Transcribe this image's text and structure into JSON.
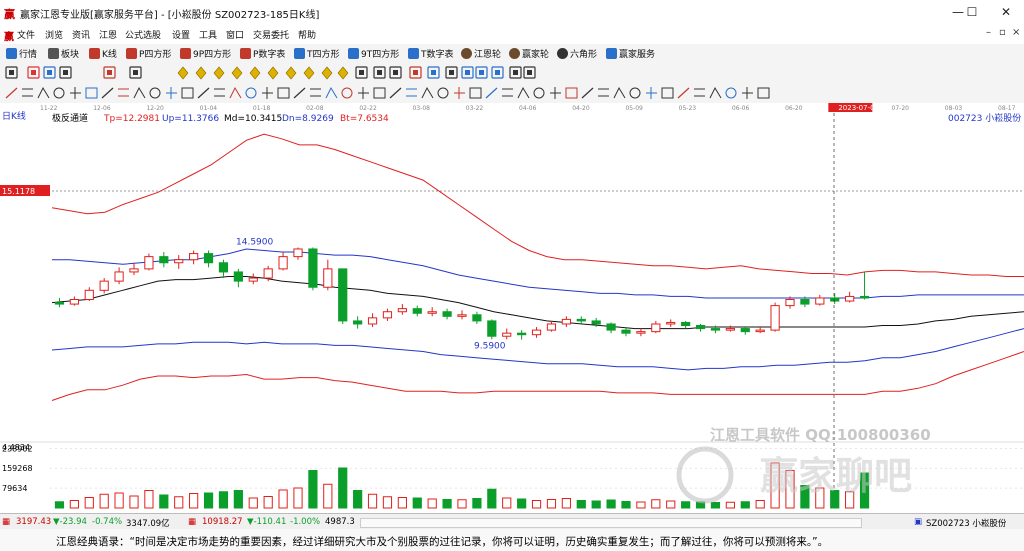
{
  "window": {
    "app_logo": "赢",
    "title": "赢家江恩专业版[赢家服务平台] - [小崧股份   SZ002723-185日K线]",
    "minimize": "—",
    "maximize": "☐",
    "close": "✕"
  },
  "menu": {
    "logo": "赢",
    "items": [
      "文件",
      "浏览",
      "资讯",
      "江恩",
      "公式选股",
      "设置",
      "工具",
      "窗口",
      "交易委托",
      "帮助"
    ],
    "win_controls": [
      "–",
      "▫",
      "×"
    ]
  },
  "toolbar1": {
    "items": [
      {
        "label": "行情",
        "color": "#2a6fc9"
      },
      {
        "label": "板块",
        "color": "#333"
      },
      {
        "label": "K线",
        "color": "#c0392b"
      },
      {
        "label": "P四方形",
        "color": "#c0392b"
      },
      {
        "label": "9P四方形",
        "color": "#c0392b"
      },
      {
        "label": "P数字表",
        "color": "#c0392b"
      },
      {
        "label": "T四方形",
        "color": "#2a6fc9"
      },
      {
        "label": "9T四方形",
        "color": "#2a6fc9"
      },
      {
        "label": "T数字表",
        "color": "#2a6fc9"
      },
      {
        "label": "江恩轮",
        "color": "#333"
      },
      {
        "label": "赢家轮",
        "color": "#333"
      },
      {
        "label": "六角形",
        "color": "#333"
      },
      {
        "label": "赢家服务",
        "color": "#333"
      }
    ]
  },
  "chart_header": {
    "period": "日K线",
    "indicator": "极反通道",
    "tp_label": "Tp=12.2981",
    "up_label": "Up=11.3766",
    "md_label": "Md=10.3415",
    "dn_label": "Dn=8.9269",
    "bt_label": "Bt=7.6534",
    "stock": "002723 小崧股份"
  },
  "chart_data": {
    "type": "candlestick",
    "price_ylim": [
      6.8,
      16.6
    ],
    "price_marker": "15.1178",
    "high_annotation": "14.5900",
    "low_annotation": "9.5900",
    "cursor_date": "2023-07-04",
    "x_ticks": [
      "11-22",
      "12-06",
      "12-20",
      "01-04",
      "01-18",
      "02-08",
      "02-22",
      "03-08",
      "03-22",
      "04-06",
      "04-20",
      "05-09",
      "05-23",
      "06-06",
      "06-20",
      "2023-07-04",
      "07-20",
      "08-03",
      "08-17"
    ],
    "volume_ticks": [
      "4.4834",
      "238902",
      "159268",
      "79634"
    ],
    "bands": {
      "top_red": [
        13.9,
        13.8,
        13.7,
        13.75,
        14.0,
        14.2,
        14.4,
        14.7,
        15.0,
        15.3,
        15.7,
        16.1,
        16.3,
        16.15,
        15.95,
        15.95,
        15.8,
        15.6,
        15.4,
        15.2,
        15.0,
        14.8,
        14.4,
        14.0,
        13.6,
        13.2,
        12.8,
        12.5,
        12.3,
        12.2,
        12.2,
        12.15,
        12.1,
        12.05,
        12.0,
        12.0,
        11.95,
        11.9,
        11.95,
        12.0,
        11.9,
        11.85,
        11.8,
        11.75,
        11.75,
        11.7,
        11.8,
        11.85,
        11.85,
        11.8,
        11.8,
        11.75,
        11.7,
        11.7,
        11.65,
        11.65
      ],
      "upper_blue": [
        12.2,
        12.2,
        12.15,
        12.1,
        12.05,
        12.1,
        12.15,
        12.2,
        12.2,
        12.3,
        12.4,
        12.55,
        12.5,
        12.45,
        12.45,
        12.4,
        12.35,
        12.35,
        12.3,
        12.2,
        12.1,
        12.0,
        11.85,
        11.7,
        11.6,
        11.5,
        11.4,
        11.3,
        11.25,
        11.2,
        11.15,
        11.1,
        11.1,
        11.05,
        11.05,
        11.0,
        11.0,
        10.95,
        10.95,
        10.95,
        10.95,
        10.95,
        10.95,
        10.95,
        10.95,
        10.95,
        10.95,
        11.0,
        11.0,
        11.05,
        11.05,
        11.05,
        11.05,
        11.05,
        11.05,
        11.05
      ],
      "mid_black": [
        10.8,
        10.85,
        10.9,
        11.05,
        11.2,
        11.35,
        11.5,
        11.55,
        11.55,
        11.6,
        11.65,
        11.65,
        11.6,
        11.5,
        11.45,
        11.4,
        11.3,
        11.25,
        11.2,
        11.1,
        11.05,
        11.0,
        10.9,
        10.8,
        10.65,
        10.5,
        10.4,
        10.3,
        10.2,
        10.15,
        10.1,
        10.05,
        10.0,
        9.95,
        9.95,
        9.95,
        9.95,
        10.0,
        10.0,
        10.0,
        10.0,
        10.0,
        10.0,
        10.0,
        10.0,
        10.0,
        10.0,
        10.05,
        10.05,
        10.1,
        10.2,
        10.25,
        10.35,
        10.4,
        10.45,
        10.5
      ],
      "lower_blue": [
        9.25,
        9.3,
        9.35,
        9.35,
        9.35,
        9.4,
        9.45,
        9.45,
        9.5,
        9.5,
        9.5,
        9.45,
        9.5,
        9.45,
        9.45,
        9.45,
        9.4,
        9.4,
        9.35,
        9.3,
        9.25,
        9.2,
        9.1,
        9.05,
        9.0,
        8.95,
        8.9,
        8.85,
        8.8,
        8.8,
        8.8,
        8.75,
        8.7,
        8.7,
        8.7,
        8.65,
        8.6,
        8.65,
        8.65,
        8.7,
        8.7,
        8.75,
        8.75,
        8.8,
        8.85,
        8.85,
        8.9,
        9.0,
        9.0,
        9.1,
        9.2,
        9.35,
        9.5,
        9.65,
        9.8,
        9.95
      ],
      "bottom_red": [
        7.6,
        7.8,
        7.95,
        7.95,
        8.1,
        8.3,
        8.4,
        8.4,
        8.35,
        8.4,
        8.4,
        8.45,
        8.3,
        8.3,
        8.35,
        8.35,
        8.25,
        8.2,
        8.1,
        8.0,
        7.9,
        7.9,
        7.9,
        7.85,
        7.85,
        7.9,
        7.9,
        7.9,
        7.9,
        7.9,
        7.9,
        7.9,
        7.85,
        7.85,
        7.85,
        7.8,
        7.8,
        7.8,
        7.8,
        7.8,
        7.8,
        7.8,
        7.8,
        7.8,
        7.8,
        7.8,
        7.8,
        7.9,
        7.9,
        8.0,
        8.15,
        8.4,
        8.6,
        8.8,
        9.0,
        9.2
      ]
    },
    "candles": [
      {
        "o": 10.8,
        "c": 10.75,
        "h": 10.95,
        "l": 10.65,
        "v": 25000
      },
      {
        "o": 10.75,
        "c": 10.9,
        "h": 11.0,
        "l": 10.7,
        "v": 30000
      },
      {
        "o": 10.9,
        "c": 11.2,
        "h": 11.3,
        "l": 10.85,
        "v": 42000
      },
      {
        "o": 11.2,
        "c": 11.5,
        "h": 11.6,
        "l": 11.1,
        "v": 55000
      },
      {
        "o": 11.5,
        "c": 11.8,
        "h": 11.95,
        "l": 11.4,
        "v": 60000
      },
      {
        "o": 11.8,
        "c": 11.9,
        "h": 12.1,
        "l": 11.7,
        "v": 48000
      },
      {
        "o": 11.9,
        "c": 12.3,
        "h": 12.4,
        "l": 11.85,
        "v": 70000
      },
      {
        "o": 12.3,
        "c": 12.1,
        "h": 12.45,
        "l": 11.95,
        "v": 52000
      },
      {
        "o": 12.1,
        "c": 12.2,
        "h": 12.35,
        "l": 11.9,
        "v": 45000
      },
      {
        "o": 12.2,
        "c": 12.4,
        "h": 12.5,
        "l": 12.05,
        "v": 58000
      },
      {
        "o": 12.4,
        "c": 12.1,
        "h": 12.5,
        "l": 11.95,
        "v": 60000
      },
      {
        "o": 12.1,
        "c": 11.8,
        "h": 12.2,
        "l": 11.6,
        "v": 65000
      },
      {
        "o": 11.8,
        "c": 11.5,
        "h": 11.9,
        "l": 11.3,
        "v": 70000
      },
      {
        "o": 11.5,
        "c": 11.6,
        "h": 11.75,
        "l": 11.4,
        "v": 40000
      },
      {
        "o": 11.6,
        "c": 11.9,
        "h": 12.0,
        "l": 11.5,
        "v": 46000
      },
      {
        "o": 11.9,
        "c": 12.3,
        "h": 12.45,
        "l": 11.85,
        "v": 72000
      },
      {
        "o": 12.3,
        "c": 12.55,
        "h": 12.6,
        "l": 12.2,
        "v": 80000
      },
      {
        "o": 12.55,
        "c": 11.3,
        "h": 12.6,
        "l": 11.2,
        "v": 150000
      },
      {
        "o": 11.3,
        "c": 11.9,
        "h": 12.2,
        "l": 11.2,
        "v": 95000
      },
      {
        "o": 11.9,
        "c": 10.2,
        "h": 11.9,
        "l": 10.1,
        "v": 160000
      },
      {
        "o": 10.2,
        "c": 10.1,
        "h": 10.35,
        "l": 9.95,
        "v": 70000
      },
      {
        "o": 10.1,
        "c": 10.3,
        "h": 10.45,
        "l": 10.0,
        "v": 55000
      },
      {
        "o": 10.3,
        "c": 10.5,
        "h": 10.6,
        "l": 10.2,
        "v": 45000
      },
      {
        "o": 10.5,
        "c": 10.6,
        "h": 10.75,
        "l": 10.4,
        "v": 42000
      },
      {
        "o": 10.6,
        "c": 10.45,
        "h": 10.7,
        "l": 10.35,
        "v": 40000
      },
      {
        "o": 10.45,
        "c": 10.5,
        "h": 10.65,
        "l": 10.35,
        "v": 36000
      },
      {
        "o": 10.5,
        "c": 10.35,
        "h": 10.6,
        "l": 10.25,
        "v": 34000
      },
      {
        "o": 10.35,
        "c": 10.4,
        "h": 10.55,
        "l": 10.25,
        "v": 33000
      },
      {
        "o": 10.4,
        "c": 10.2,
        "h": 10.5,
        "l": 10.1,
        "v": 38000
      },
      {
        "o": 10.2,
        "c": 9.7,
        "h": 10.25,
        "l": 9.6,
        "v": 75000
      },
      {
        "o": 9.7,
        "c": 9.8,
        "h": 9.95,
        "l": 9.6,
        "v": 40000
      },
      {
        "o": 9.8,
        "c": 9.75,
        "h": 9.9,
        "l": 9.59,
        "v": 36000
      },
      {
        "o": 9.75,
        "c": 9.9,
        "h": 10.0,
        "l": 9.65,
        "v": 30000
      },
      {
        "o": 9.9,
        "c": 10.1,
        "h": 10.2,
        "l": 9.85,
        "v": 34000
      },
      {
        "o": 10.1,
        "c": 10.25,
        "h": 10.35,
        "l": 10.0,
        "v": 38000
      },
      {
        "o": 10.25,
        "c": 10.2,
        "h": 10.35,
        "l": 10.1,
        "v": 30000
      },
      {
        "o": 10.2,
        "c": 10.1,
        "h": 10.3,
        "l": 10.0,
        "v": 28000
      },
      {
        "o": 10.1,
        "c": 9.9,
        "h": 10.15,
        "l": 9.8,
        "v": 32000
      },
      {
        "o": 9.9,
        "c": 9.8,
        "h": 10.0,
        "l": 9.7,
        "v": 26000
      },
      {
        "o": 9.8,
        "c": 9.85,
        "h": 9.95,
        "l": 9.7,
        "v": 24000
      },
      {
        "o": 9.85,
        "c": 10.1,
        "h": 10.2,
        "l": 9.8,
        "v": 33000
      },
      {
        "o": 10.1,
        "c": 10.15,
        "h": 10.25,
        "l": 10.0,
        "v": 28000
      },
      {
        "o": 10.15,
        "c": 10.05,
        "h": 10.2,
        "l": 9.95,
        "v": 25000
      },
      {
        "o": 10.05,
        "c": 9.95,
        "h": 10.1,
        "l": 9.85,
        "v": 24000
      },
      {
        "o": 9.95,
        "c": 9.9,
        "h": 10.05,
        "l": 9.8,
        "v": 22000
      },
      {
        "o": 9.9,
        "c": 9.95,
        "h": 10.05,
        "l": 9.85,
        "v": 23000
      },
      {
        "o": 9.95,
        "c": 9.85,
        "h": 10.0,
        "l": 9.75,
        "v": 25000
      },
      {
        "o": 9.85,
        "c": 9.9,
        "h": 10.0,
        "l": 9.8,
        "v": 30000
      },
      {
        "o": 9.9,
        "c": 10.7,
        "h": 10.8,
        "l": 9.85,
        "v": 180000
      },
      {
        "o": 10.7,
        "c": 10.9,
        "h": 11.0,
        "l": 10.6,
        "v": 150000
      },
      {
        "o": 10.9,
        "c": 10.75,
        "h": 11.0,
        "l": 10.65,
        "v": 90000
      },
      {
        "o": 10.75,
        "c": 10.95,
        "h": 11.05,
        "l": 10.7,
        "v": 80000
      },
      {
        "o": 10.95,
        "c": 10.85,
        "h": 11.1,
        "l": 10.75,
        "v": 70000
      },
      {
        "o": 10.85,
        "c": 11.0,
        "h": 11.15,
        "l": 10.8,
        "v": 65000
      },
      {
        "o": 11.0,
        "c": 10.95,
        "h": 11.8,
        "l": 10.9,
        "v": 140000
      }
    ]
  },
  "status": {
    "sh_index": "3197.43",
    "sh_change": "▼-23.94",
    "sh_pct": "-0.74%",
    "sh_amount": "3347.09亿",
    "sz_index": "10918.27",
    "sz_change": "▼-110.41",
    "sz_pct": "-1.00%",
    "sz_amount": "4987.3",
    "current_stock": "SZ002723 小崧股份"
  },
  "quote": "江恩经典语录：“时间是决定市场走势的重要因素，经过详细研究大市及个别股票的过往记录，你将可以证明，历史确实重复发生；而了解过往，你将可以预测将来。”。",
  "colors": {
    "up": "#e0201b",
    "down": "#0b9e2b",
    "band_red": "#e02020",
    "band_blue": "#2436c8",
    "mid": "#111111"
  }
}
